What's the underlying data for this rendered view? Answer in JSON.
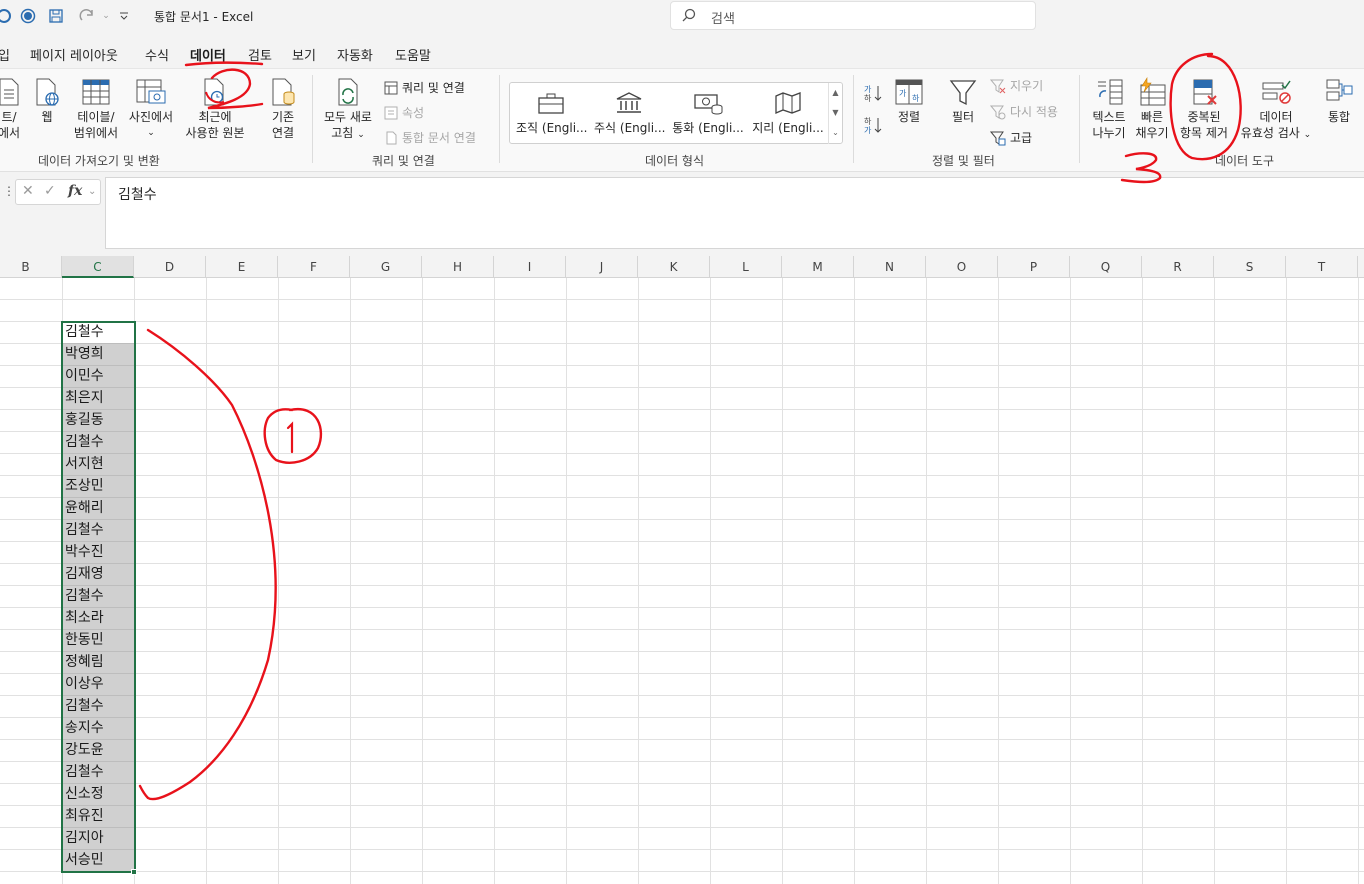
{
  "titlebar": {
    "title": "통합 문서1  -  Excel",
    "search_placeholder": "검색"
  },
  "tabs": [
    {
      "label": "입",
      "active": false
    },
    {
      "label": "페이지 레이아웃",
      "active": false
    },
    {
      "label": "수식",
      "active": false
    },
    {
      "label": "데이터",
      "active": true
    },
    {
      "label": "검토",
      "active": false
    },
    {
      "label": "보기",
      "active": false
    },
    {
      "label": "자동화",
      "active": false
    },
    {
      "label": "도움말",
      "active": false
    }
  ],
  "ribbon": {
    "get_transform": {
      "group_label": "데이터 가져오기 및 변환",
      "from_text_line1": "트/",
      "from_text_line2": "에서",
      "web": "웹",
      "from_table_line1": "테이블/",
      "from_table_line2": "범위에서",
      "from_picture": "사진에서",
      "recent_line1": "최근에",
      "recent_line2": "사용한 원본",
      "existing_line1": "기존",
      "existing_line2": "연결"
    },
    "queries": {
      "group_label": "쿼리 및 연결",
      "refresh_line1": "모두 새로",
      "refresh_line2": "고침",
      "queries_connections": "쿼리 및 연결",
      "properties": "속성",
      "edit_links": "통합 문서 연결"
    },
    "data_types": {
      "group_label": "데이터 형식",
      "items": [
        "조직 (Engli...",
        "주식 (Engli...",
        "통화 (Engli...",
        "지리 (Engli..."
      ]
    },
    "sort_filter": {
      "group_label": "정렬 및 필터",
      "sort": "정렬",
      "filter": "필터",
      "clear": "지우기",
      "reapply": "다시 적용",
      "advanced": "고급"
    },
    "data_tools": {
      "group_label": "데이터 도구",
      "text_to_columns_line1": "텍스트",
      "text_to_columns_line2": "나누기",
      "flash_fill_line1": "빠른",
      "flash_fill_line2": "채우기",
      "remove_dup_line1": "중복된",
      "remove_dup_line2": "항목 제거",
      "validation_line1": "데이터",
      "validation_line2": "유효성 검사",
      "consolidate": "통합"
    }
  },
  "formula_bar": {
    "value": "김철수"
  },
  "columns": [
    "B",
    "C",
    "D",
    "E",
    "F",
    "G",
    "H",
    "I",
    "J",
    "K",
    "L",
    "M",
    "N",
    "O",
    "P",
    "Q",
    "R",
    "S",
    "T"
  ],
  "selected_column": "C",
  "names": [
    "김철수",
    "박영희",
    "이민수",
    "최은지",
    "홍길동",
    "김철수",
    "서지현",
    "조상민",
    "윤해리",
    "김철수",
    "박수진",
    "김재영",
    "김철수",
    "최소라",
    "한동민",
    "정혜림",
    "이상우",
    "김철수",
    "송지수",
    "강도윤",
    "김철수",
    "신소정",
    "최유진",
    "김지아",
    "서승민"
  ]
}
